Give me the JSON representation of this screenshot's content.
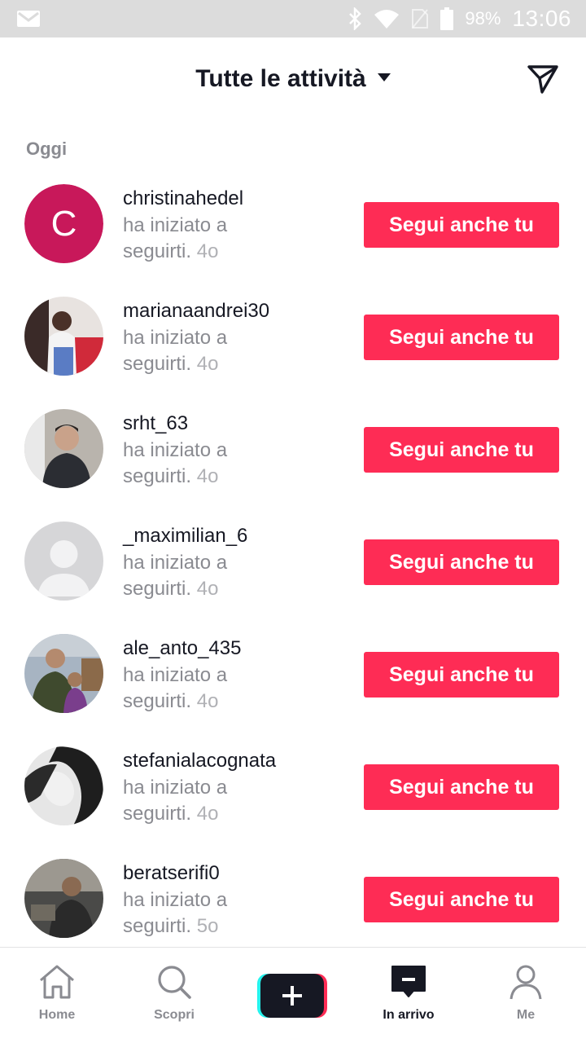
{
  "status_bar": {
    "battery_percent": "98%",
    "time": "13:06"
  },
  "header": {
    "title": "Tutte le attività"
  },
  "section": {
    "label": "Oggi"
  },
  "notifications": [
    {
      "username": "christinahedel",
      "line1": "ha iniziato a",
      "line2": "seguirti.",
      "ago": "4o",
      "button": "Segui anche tu",
      "avatar": "letter-c"
    },
    {
      "username": "marianaandrei30",
      "line1": "ha iniziato a",
      "line2": "seguirti.",
      "ago": "4o",
      "button": "Segui anche tu",
      "avatar": "photo"
    },
    {
      "username": "srht_63",
      "line1": "ha iniziato a",
      "line2": "seguirti.",
      "ago": "4o",
      "button": "Segui anche tu",
      "avatar": "photo"
    },
    {
      "username": "_maximilian_6",
      "line1": "ha iniziato a",
      "line2": "seguirti.",
      "ago": "4o",
      "button": "Segui anche tu",
      "avatar": "default"
    },
    {
      "username": "ale_anto_435",
      "line1": "ha iniziato a",
      "line2": "seguirti.",
      "ago": "4o",
      "button": "Segui anche tu",
      "avatar": "photo"
    },
    {
      "username": "stefanialacognata",
      "line1": "ha iniziato a",
      "line2": "seguirti.",
      "ago": "4o",
      "button": "Segui anche tu",
      "avatar": "photo"
    },
    {
      "username": "beratserifi0",
      "line1": "ha iniziato a",
      "line2": "seguirti.",
      "ago": "5o",
      "button": "Segui anche tu",
      "avatar": "photo"
    }
  ],
  "avatar_letter": "C",
  "bottom_nav": {
    "home": "Home",
    "discover": "Scopri",
    "inbox": "In arrivo",
    "me": "Me"
  },
  "colors": {
    "accent": "#fe2c55",
    "avatar_c": "#c8185a",
    "text_primary": "#161823",
    "text_secondary": "#8a8b91"
  }
}
